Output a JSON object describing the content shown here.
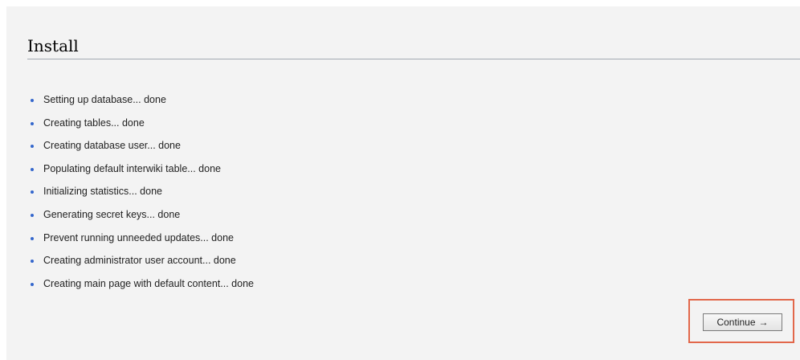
{
  "install": {
    "title": "Install",
    "steps": [
      "Setting up database... done",
      "Creating tables... done",
      "Creating database user... done",
      "Populating default interwiki table... done",
      "Initializing statistics... done",
      "Generating secret keys... done",
      "Prevent running unneeded updates... done",
      "Creating administrator user account... done",
      "Creating main page with default content... done"
    ],
    "continue_label": "Continue",
    "continue_arrow": "→"
  },
  "colors": {
    "bullet": "#3366cc",
    "panel_background": "#f3f3f3",
    "highlight_box": "#e2674a"
  }
}
